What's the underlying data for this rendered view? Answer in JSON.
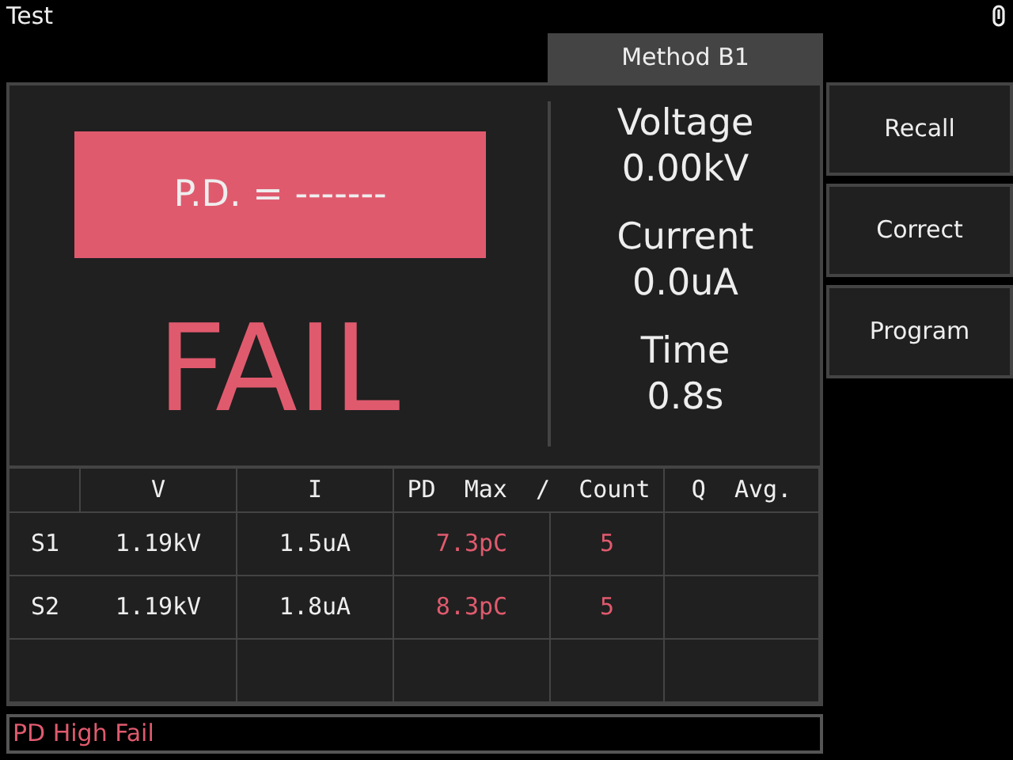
{
  "title": "Test",
  "tab": {
    "label": "Method B1",
    "selected": true
  },
  "result": {
    "pd_label": "P.D. = -------",
    "verdict": "FAIL"
  },
  "readings": [
    {
      "label": "Voltage",
      "value": "0.00kV"
    },
    {
      "label": "Current",
      "value": "0.0uA"
    },
    {
      "label": "Time",
      "value": "0.8s"
    }
  ],
  "buttons": [
    "Recall",
    "Correct",
    "Program"
  ],
  "table": {
    "columns": [
      "V",
      "I",
      "PD  Max  /  Count",
      "Q  Avg."
    ],
    "rows": [
      {
        "label": "S1",
        "cells": [
          {
            "text": "1.19kV",
            "alert": false
          },
          {
            "text": "1.5uA",
            "alert": false
          },
          {
            "text": "7.3pC",
            "alert": true
          },
          {
            "text": "5",
            "alert": true
          }
        ]
      },
      {
        "label": "S2",
        "cells": [
          {
            "text": "1.19kV",
            "alert": false
          },
          {
            "text": "1.8uA",
            "alert": false
          },
          {
            "text": "8.3pC",
            "alert": true
          },
          {
            "text": "5",
            "alert": true
          }
        ]
      }
    ]
  },
  "status": {
    "text": "PD High Fail",
    "alert": true
  }
}
